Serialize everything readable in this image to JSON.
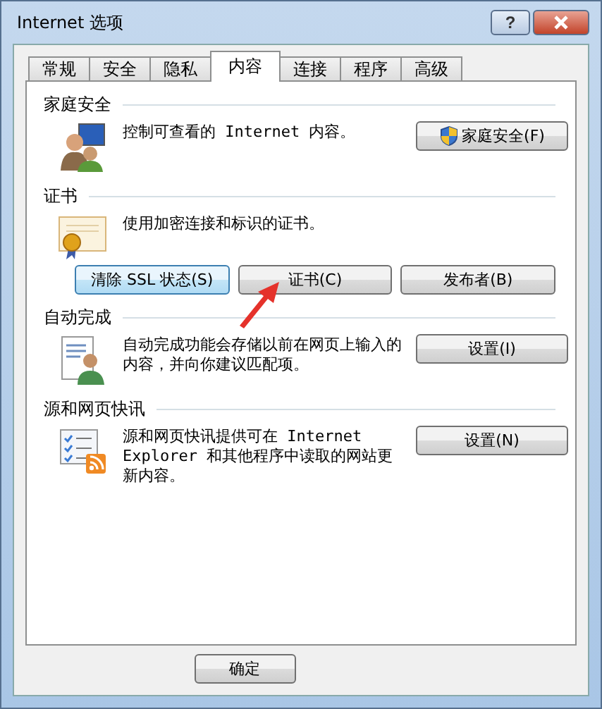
{
  "window": {
    "title": "Internet 选项",
    "help_label": "?"
  },
  "tabs": [
    {
      "label": "常规",
      "selected": false
    },
    {
      "label": "安全",
      "selected": false
    },
    {
      "label": "隐私",
      "selected": false
    },
    {
      "label": "内容",
      "selected": true
    },
    {
      "label": "连接",
      "selected": false
    },
    {
      "label": "程序",
      "selected": false
    },
    {
      "label": "高级",
      "selected": false
    }
  ],
  "sections": [
    {
      "heading": "家庭安全",
      "description": "控制可查看的 Internet 内容。",
      "kind": "side",
      "buttons": [
        {
          "label": "家庭安全(F)",
          "shield": true,
          "hot": false
        }
      ]
    },
    {
      "heading": "证书",
      "description": "使用加密连接和标识的证书。",
      "kind": "row",
      "buttons": [
        {
          "label": "清除 SSL 状态(S)",
          "shield": false,
          "hot": true
        },
        {
          "label": "证书(C)",
          "shield": false,
          "hot": false
        },
        {
          "label": "发布者(B)",
          "shield": false,
          "hot": false
        }
      ]
    },
    {
      "heading": "自动完成",
      "description": "自动完成功能会存储以前在网页上输入的内容，并向你建议匹配项。",
      "kind": "side",
      "buttons": [
        {
          "label": "设置(I)",
          "shield": false,
          "hot": false
        }
      ]
    },
    {
      "heading": "源和网页快讯",
      "description": "源和网页快讯提供可在 Internet Explorer 和其他程序中读取的网站更新内容。",
      "kind": "side",
      "buttons": [
        {
          "label": "设置(N)",
          "shield": false,
          "hot": false
        }
      ]
    }
  ],
  "footer_buttons": [
    {
      "label": "确定"
    }
  ]
}
